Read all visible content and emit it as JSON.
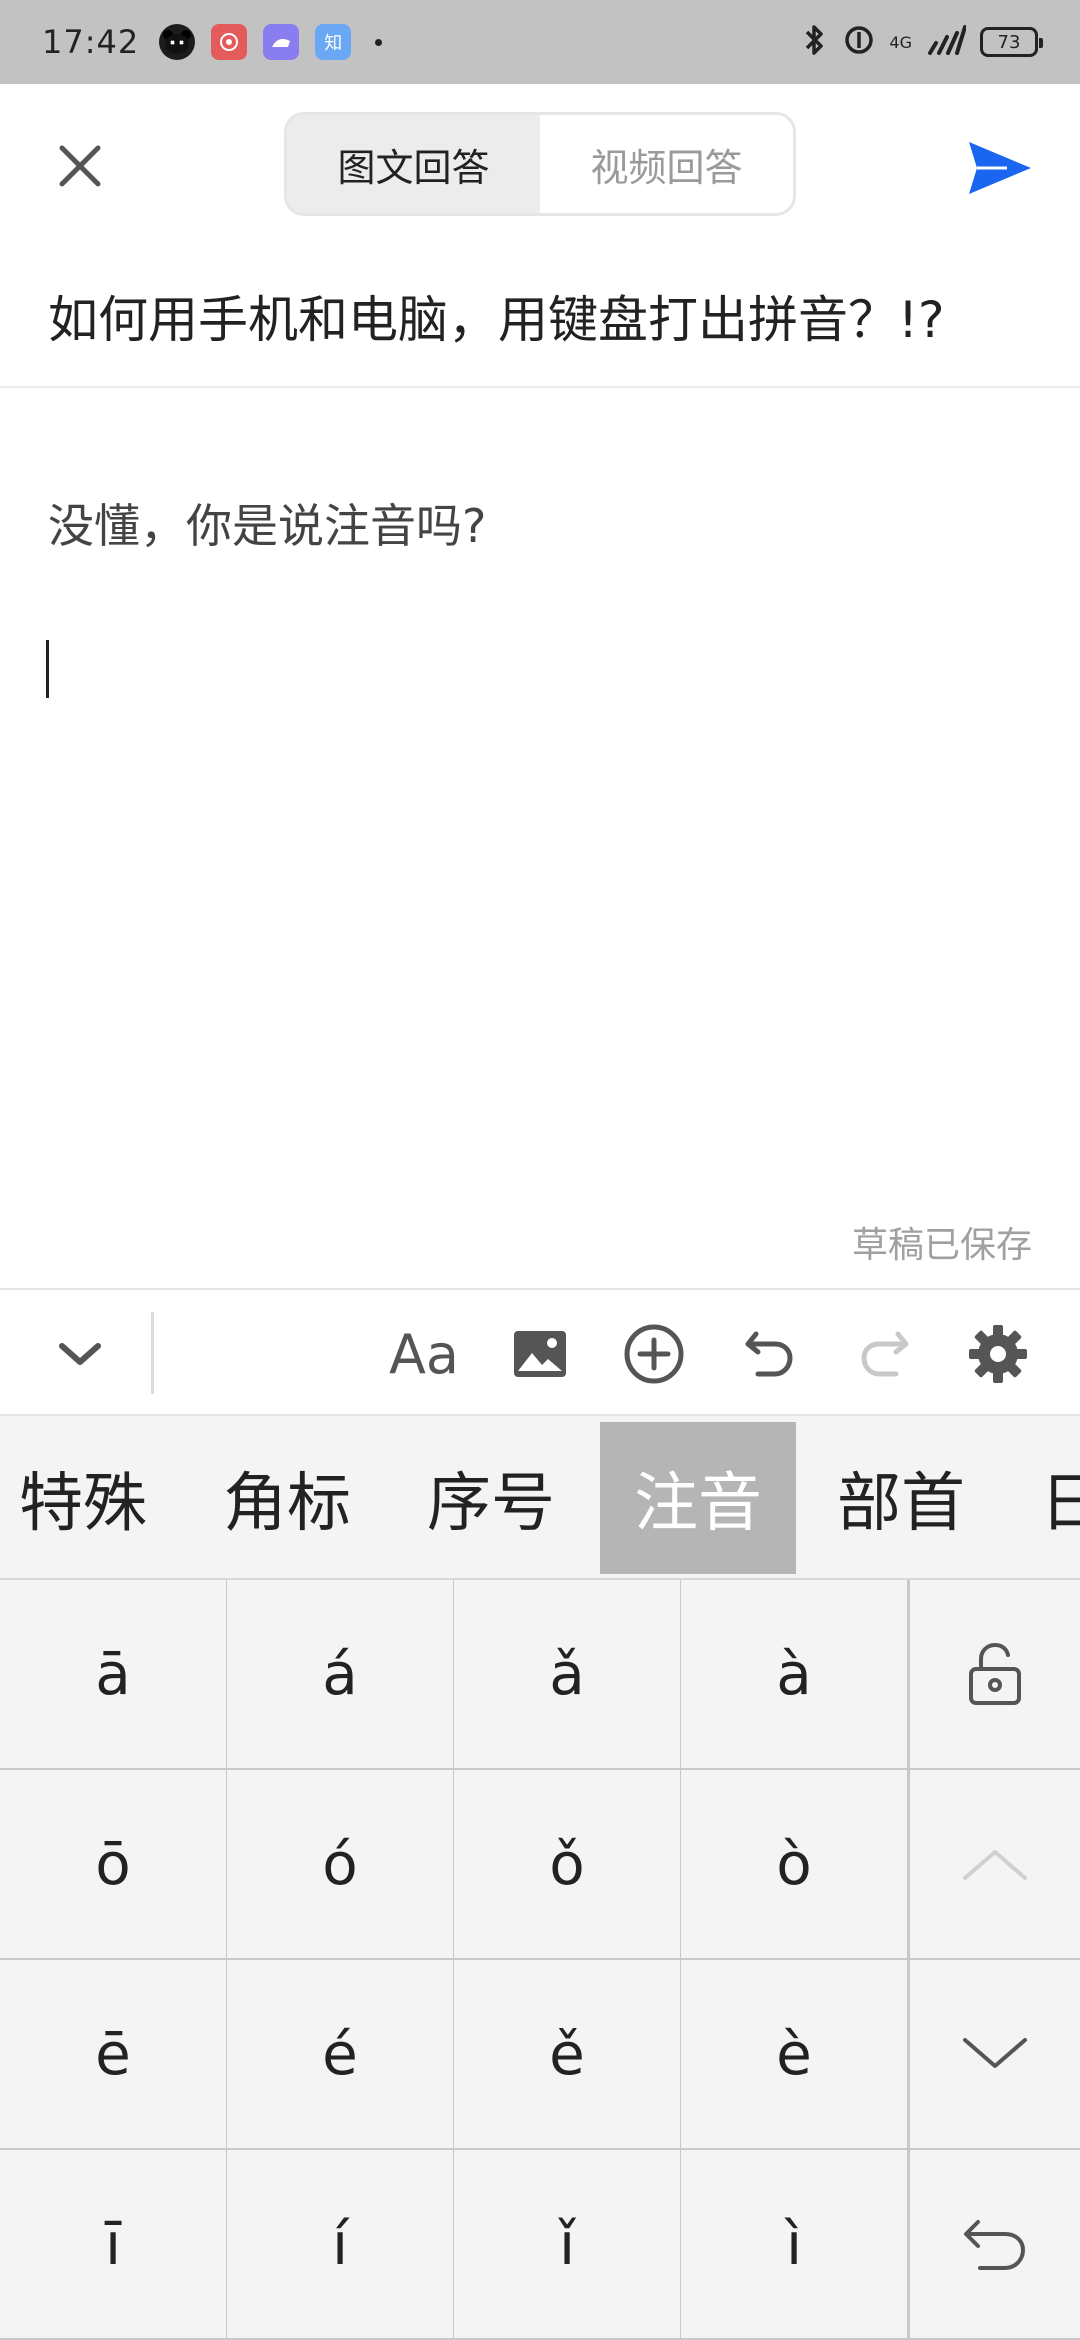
{
  "status_bar": {
    "time": "17:42",
    "apps": [
      {
        "name": "panda-app",
        "color": "#222222",
        "label": ""
      },
      {
        "name": "red-app",
        "color": "#e45b5b",
        "label": ""
      },
      {
        "name": "purple-app",
        "color": "#8a7df0",
        "label": ""
      },
      {
        "name": "zhihu-app",
        "color": "#6aa8f5",
        "label": "知"
      }
    ],
    "network": "4G",
    "battery": "73"
  },
  "header": {
    "tabs": [
      {
        "label": "图文回答",
        "active": true
      },
      {
        "label": "视频回答",
        "active": false
      }
    ]
  },
  "question": {
    "title": "如何用手机和电脑，用键盘打出拼音？!?"
  },
  "editor": {
    "answer": "没懂，你是说注音吗?",
    "draft_status": "草稿已保存"
  },
  "toolbar": {
    "items": [
      "collapse",
      "font",
      "image",
      "insert",
      "undo",
      "redo",
      "settings"
    ],
    "font_label": "Aa"
  },
  "symbol_categories": [
    {
      "label": "特殊",
      "active": false
    },
    {
      "label": "角标",
      "active": false
    },
    {
      "label": "序号",
      "active": false
    },
    {
      "label": "注音",
      "active": true
    },
    {
      "label": "部首",
      "active": false
    },
    {
      "label": "日",
      "active": false
    }
  ],
  "keyboard": {
    "rows": [
      [
        "ā",
        "á",
        "ǎ",
        "à"
      ],
      [
        "ō",
        "ó",
        "ǒ",
        "ò"
      ],
      [
        "ē",
        "é",
        "ě",
        "è"
      ],
      [
        "ī",
        "í",
        "ǐ",
        "ì"
      ]
    ],
    "function_keys": [
      "lock",
      "page-up",
      "page-down",
      "return"
    ]
  },
  "colors": {
    "accent": "#1a66f0",
    "status_bar_bg": "#c2c2c2",
    "active_category_bg": "#b5b5b5"
  }
}
